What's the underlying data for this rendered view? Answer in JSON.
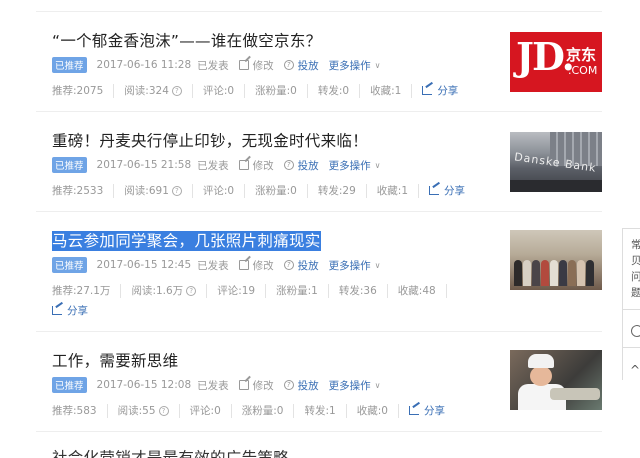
{
  "labels": {
    "badge": "已推荐",
    "published": "已发表",
    "edit": "修改",
    "cast": "投放",
    "more_ops": "更多操作",
    "rec": "推荐",
    "read": "阅读",
    "comment": "评论",
    "fans": "涨粉量",
    "repost": "转发",
    "fav": "收藏",
    "share": "分享"
  },
  "articles": [
    {
      "title": "“一个郁金香泡沫”——谁在做空京东？",
      "date": "2017-06-16 11:28",
      "rec": "2075",
      "read": "324",
      "comment": "0",
      "fans": "0",
      "repost": "0",
      "fav": "1",
      "thumb": {
        "big": "JD.",
        "cn": "京东",
        "com": ".COM"
      }
    },
    {
      "title": "重磅！丹麦央行停止印钞，无现金时代来临！",
      "date": "2017-06-15 21:58",
      "rec": "2533",
      "read": "691",
      "comment": "0",
      "fans": "0",
      "repost": "29",
      "fav": "1",
      "thumb": {
        "text": "Danske Bank"
      }
    },
    {
      "title": "马云参加同学聚会，几张照片刺痛现实",
      "date": "2017-06-15 12:45",
      "rec": "27.1万",
      "read": "1.6万",
      "comment": "19",
      "fans": "1",
      "repost": "36",
      "fav": "48"
    },
    {
      "title": "工作，需要新思维",
      "date": "2017-06-15 12:08",
      "rec": "583",
      "read": "55",
      "comment": "0",
      "fans": "0",
      "repost": "1",
      "fav": "0"
    }
  ],
  "cut_title": "社会化营销才是最有效的广告策略",
  "side": {
    "lines": [
      "常",
      "贝",
      "问",
      "题"
    ],
    "up": "^"
  }
}
